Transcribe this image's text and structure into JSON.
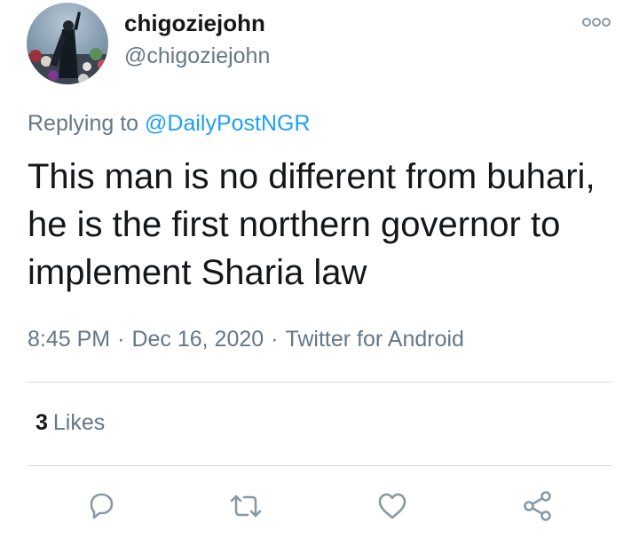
{
  "user": {
    "display_name": "chigoziejohn",
    "handle": "@chigoziejohn",
    "avatar_icon": "profile-photo"
  },
  "reply": {
    "prefix": "Replying to ",
    "mention": "@DailyPostNGR"
  },
  "tweet": {
    "text": "This man is no different from buhari, he is the first northern governor to implement Sharia law"
  },
  "meta": {
    "time": "8:45 PM",
    "date": "Dec 16, 2020",
    "separator": "·",
    "source": "Twitter for Android"
  },
  "stats": {
    "likes_count": "3",
    "likes_label": "Likes"
  },
  "actions": {
    "icons": [
      "reply-icon",
      "retweet-icon",
      "like-icon",
      "share-icon"
    ]
  },
  "colors": {
    "text": "#14171a",
    "secondary": "#657786",
    "link": "#1da1f2",
    "divider": "#d7dde2"
  }
}
